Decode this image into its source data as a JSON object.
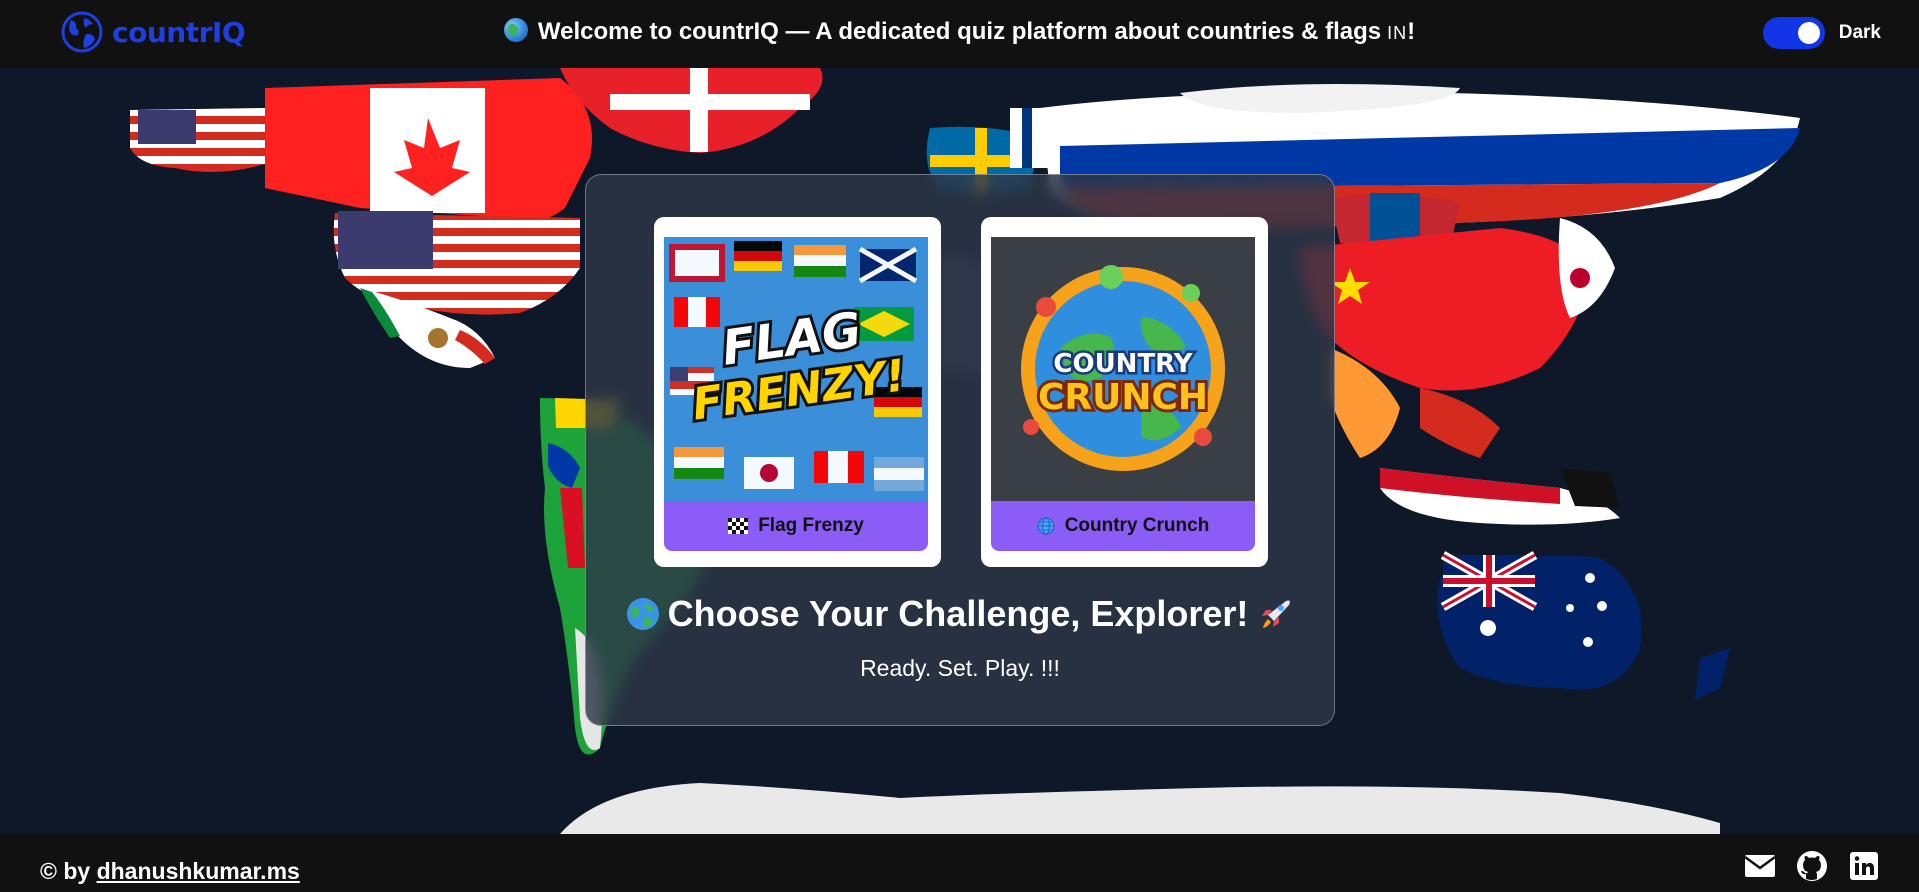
{
  "header": {
    "logo_text": "countrIQ",
    "welcome_text": "Welcome to countrIQ — A dedicated quiz platform about countries & flags",
    "welcome_flag": "IN",
    "welcome_suffix": "!",
    "theme_toggle_label": "Dark",
    "theme_toggle_on": true
  },
  "cards": [
    {
      "title": "Flag Frenzy",
      "image_text_1": "FLAG",
      "image_text_2": "FRENZY!",
      "icon": "checkered-flag-icon"
    },
    {
      "title": "Country Crunch",
      "image_text_1": "COUNTRY",
      "image_text_2": "CRUNCH",
      "icon": "globe-web-icon"
    }
  ],
  "main": {
    "heading": "Choose Your Challenge, Explorer!",
    "tagline": "Ready. Set. Play. !!!"
  },
  "footer": {
    "credit_prefix": "© by",
    "credit_link": "dhanushkumar.ms",
    "social_icons": [
      "mail-icon",
      "github-icon",
      "linkedin-icon"
    ]
  },
  "colors": {
    "header_bg": "#111111",
    "brand_blue": "#1f3fe0",
    "toggle_blue": "#1235e8",
    "card_button": "#8b5cf6",
    "map_bg": "#0e1829"
  }
}
